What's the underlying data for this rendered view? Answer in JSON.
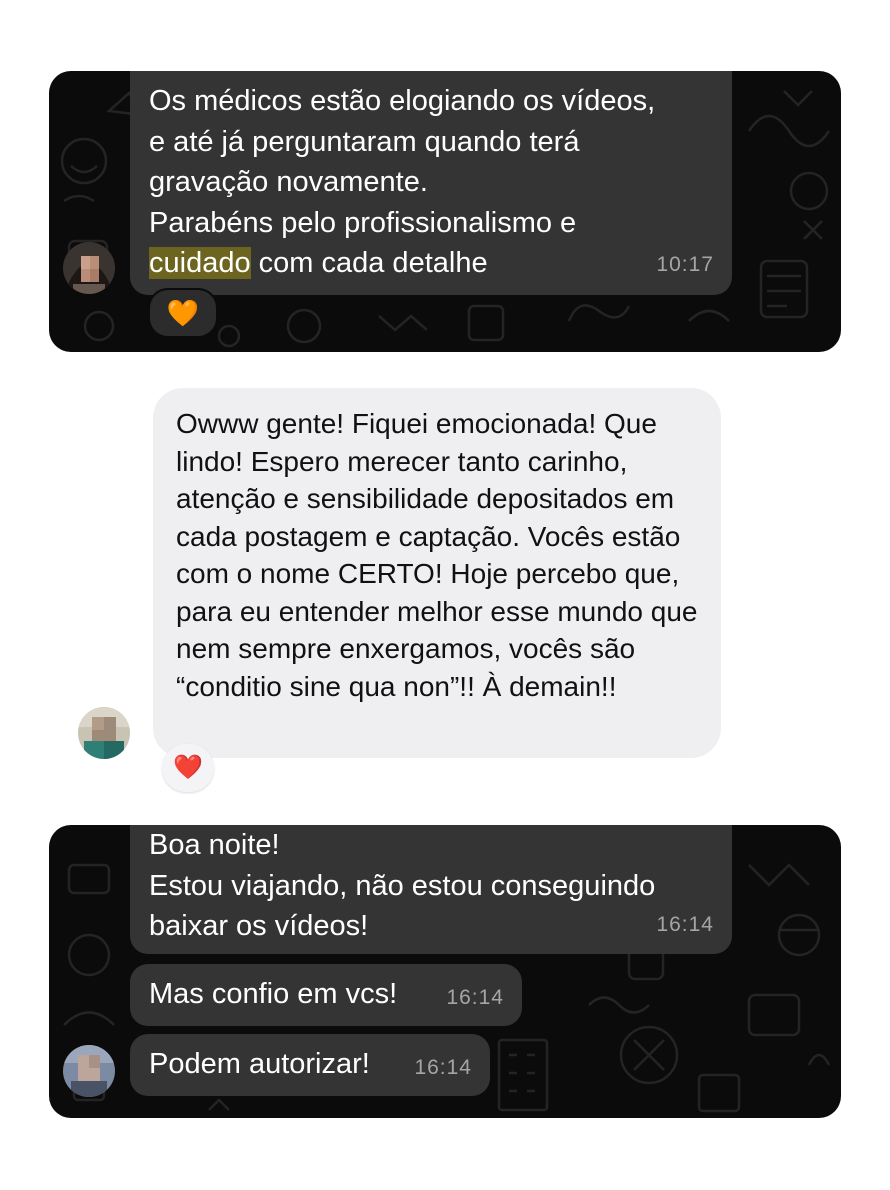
{
  "chat_1": {
    "message_lines": [
      "Os médicos estão elogiando os vídeos,",
      "e até já perguntaram quando terá",
      "gravação novamente.",
      "Parabéns pelo profissionalismo e"
    ],
    "highlighted_word": "cuidado",
    "last_line_rest": " com cada detalhe",
    "time": "10:17",
    "reaction": "🧡"
  },
  "comment": {
    "text": "Owww gente! Fiquei emocionada! Que lindo! Espero merecer tanto carinho, atenção e sensibilidade depositados em cada postagem e captação. Vocês estão com o nome CERTO! Hoje percebo que, para eu entender melhor esse mundo que nem sempre enxergamos, vocês são “conditio sine qua non”!! À demain!!",
    "reaction": "❤️"
  },
  "chat_2": {
    "messages": [
      {
        "text": "Boa noite!\nEstou viajando, não estou conseguindo\nbaixar os vídeos!",
        "time": "16:14"
      },
      {
        "text": "Mas confio em vcs!",
        "time": "16:14"
      },
      {
        "text": "Podem autorizar!",
        "time": "16:14"
      }
    ]
  },
  "colors": {
    "chat_background": "#0b0b0b",
    "dark_bubble": "#343435",
    "highlight": "#6d6420",
    "light_bubble": "#efeff2"
  }
}
